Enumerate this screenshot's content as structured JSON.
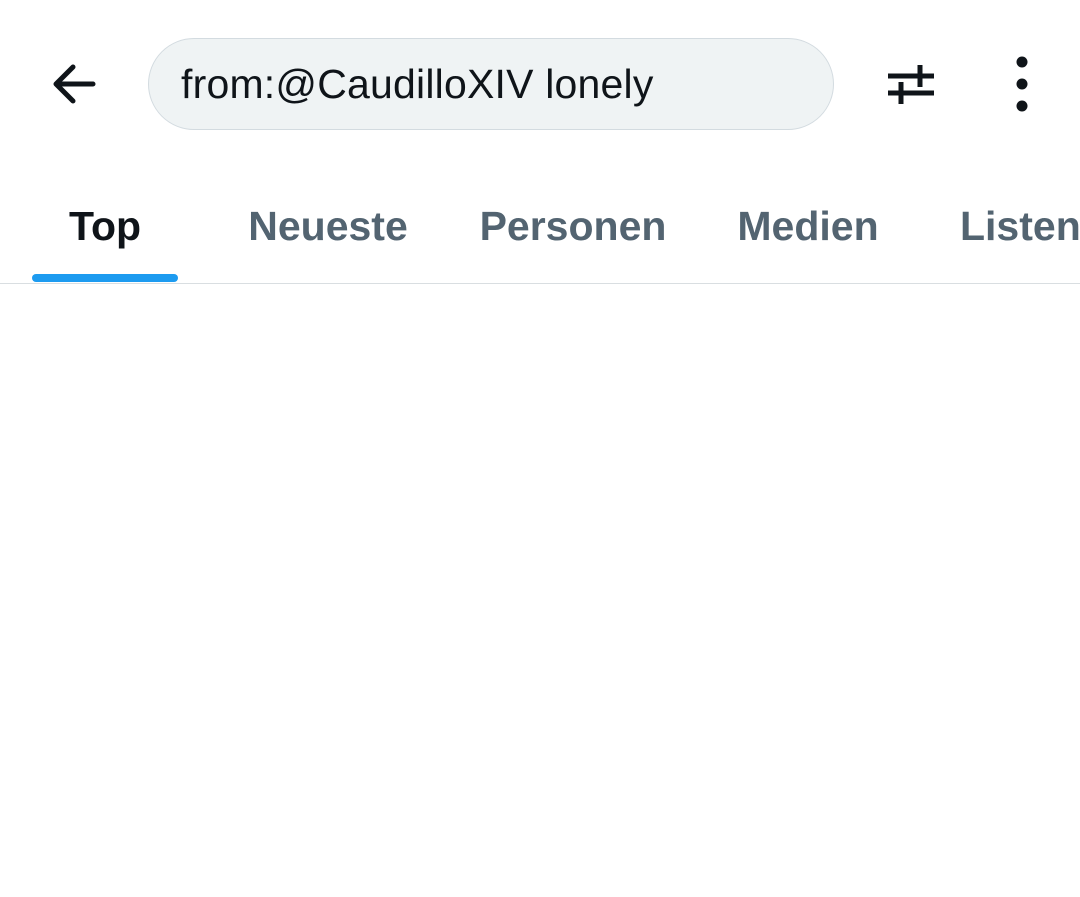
{
  "search": {
    "query": "from:@CaudilloXIV lonely"
  },
  "icons": {
    "back": "arrow-left-icon",
    "filter": "sliders-icon",
    "more": "more-vertical-icon"
  },
  "tabs": [
    {
      "label": "Top",
      "active": true
    },
    {
      "label": "Neueste",
      "active": false
    },
    {
      "label": "Personen",
      "active": false
    },
    {
      "label": "Medien",
      "active": false
    },
    {
      "label": "Listen",
      "active": false
    }
  ],
  "colors": {
    "accent": "#1d9bf0",
    "text_primary": "#0f1419",
    "text_secondary": "#536471",
    "search_bg": "#eff3f4",
    "divider": "#d9dee1"
  }
}
